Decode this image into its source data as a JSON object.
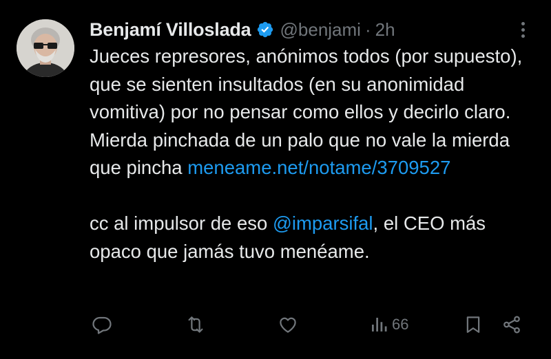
{
  "post": {
    "author": {
      "name": "Benjamí Villoslada",
      "handle": "@benjami",
      "verified": true,
      "avatar_icon": "avatar-photo"
    },
    "separator": "·",
    "time": "2h",
    "body": {
      "paragraph1": "Jueces represores, anónimos todos (por supuesto), que se sienten insultados (en su anonimidad vomitiva) por no pensar como ellos y decirlo claro. Mierda pinchada de un palo que no vale la mierda que pincha",
      "link": "meneame.net/notame/3709527",
      "p2_before": "cc al impulsor de eso ",
      "mention": "@imparsifal",
      "p2_after": ", el CEO más opaco que jamás tuvo menéame."
    },
    "actions": {
      "reply_icon": "reply-icon",
      "repost_icon": "repost-icon",
      "like_icon": "heart-icon",
      "views_icon": "views-icon",
      "views_count": "66",
      "bookmark_icon": "bookmark-icon",
      "share_icon": "share-icon"
    }
  },
  "colors": {
    "background": "#000000",
    "text": "#e7e9ea",
    "muted": "#71767b",
    "accent": "#1d9bf0"
  }
}
